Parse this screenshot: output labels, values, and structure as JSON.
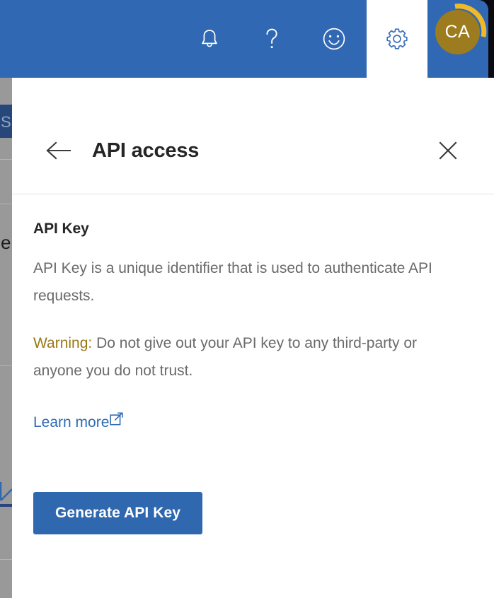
{
  "topbar": {
    "background_color": "#3168b4",
    "icons": [
      {
        "name": "notifications-icon",
        "label": "Notifications"
      },
      {
        "name": "help-icon",
        "label": "Help"
      },
      {
        "name": "feedback-icon",
        "label": "Feedback"
      }
    ],
    "settings_tab": {
      "name": "settings-gear-icon",
      "label": "Settings",
      "active": true,
      "icon_color": "#3168b4"
    },
    "avatar": {
      "initials": "CA",
      "circle_color": "#9c7c1e",
      "ring_color": "#f0b927"
    }
  },
  "backdrop": {
    "overlay_color": "#999999",
    "fragment_text": "Su",
    "fragment_letter": "e"
  },
  "panel": {
    "title": "API access",
    "back_label": "Back",
    "close_label": "Close",
    "section_title": "API Key",
    "description": "API Key is a unique identifier that is used to authenticate API requests.",
    "warning_label": "Warning:",
    "warning_text": " Do not give out your API key to any third-party or anyone you do not trust.",
    "warning_color": "#9a7715",
    "learn_more": "Learn more",
    "learn_more_color": "#2f6cb5",
    "generate_button": "Generate API Key",
    "generate_button_color": "#2f68ae"
  }
}
